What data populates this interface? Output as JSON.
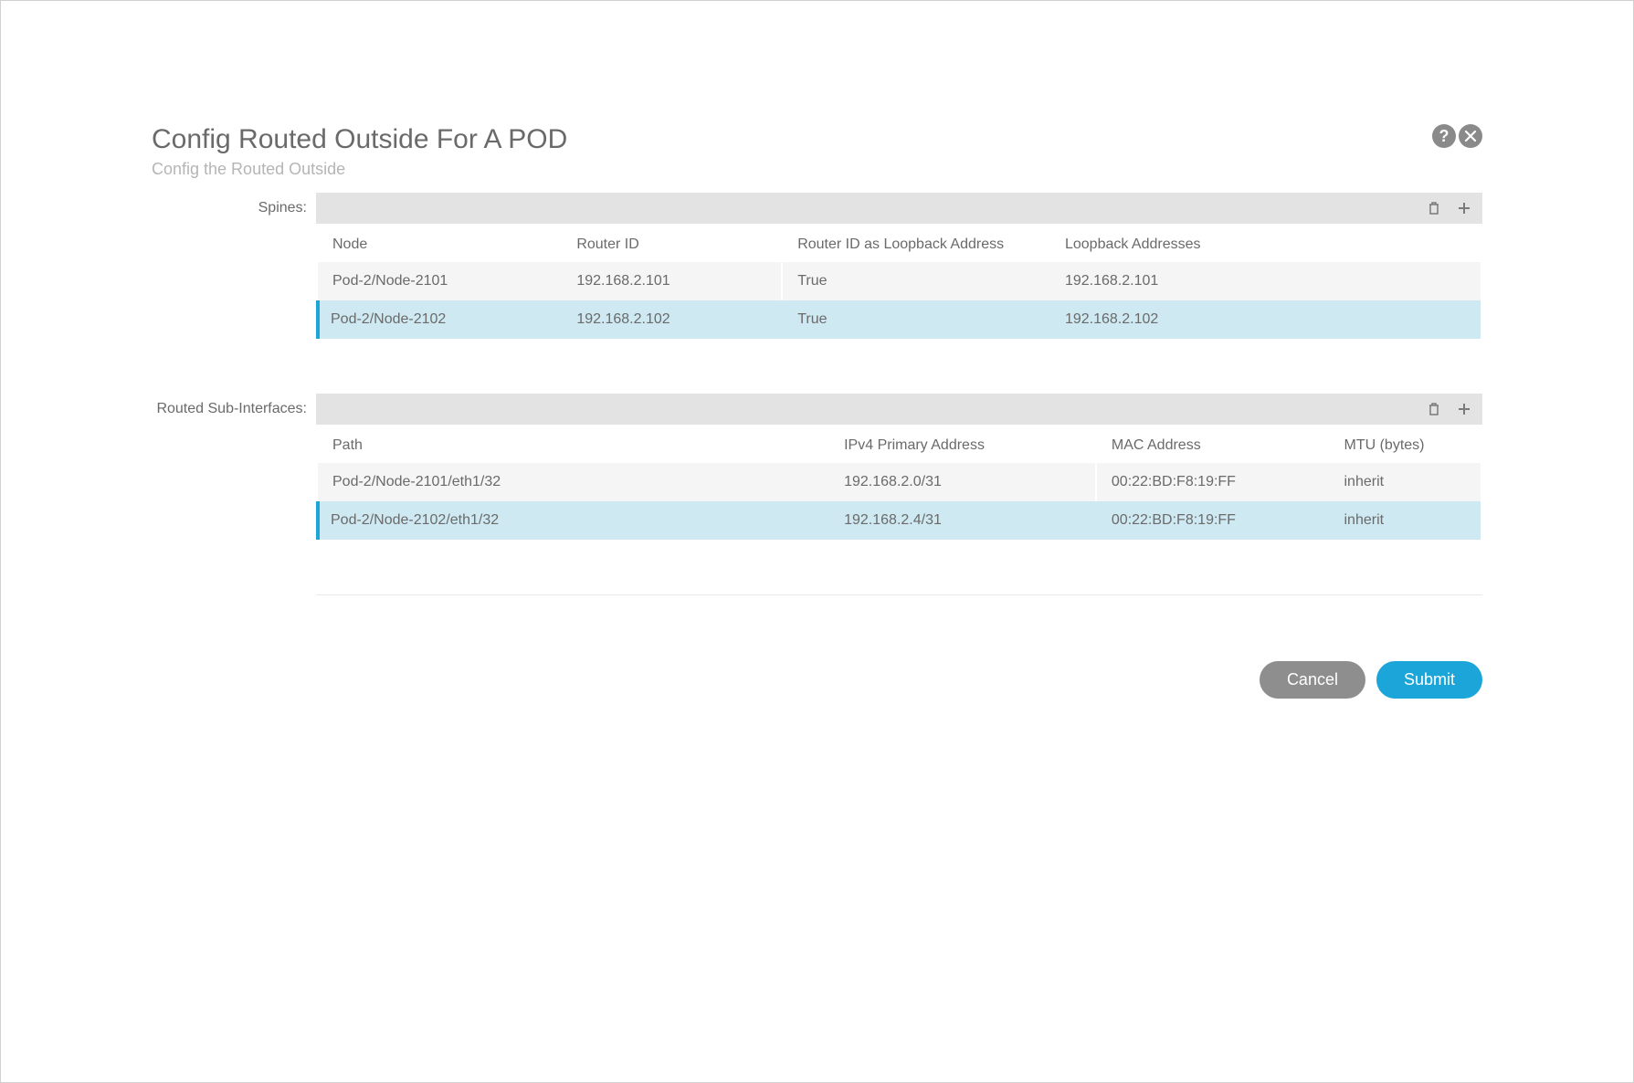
{
  "dialog": {
    "title": "Config Routed Outside For A POD",
    "subtitle": "Config the Routed Outside"
  },
  "spines": {
    "label": "Spines:",
    "columns": {
      "node": "Node",
      "router_id": "Router ID",
      "router_loopback": "Router ID as Loopback Address",
      "loopback_addresses": "Loopback Addresses"
    },
    "rows": [
      {
        "node": "Pod-2/Node-2101",
        "router_id": "192.168.2.101",
        "router_loopback": "True",
        "loopback_addresses": "192.168.2.101",
        "selected": false
      },
      {
        "node": "Pod-2/Node-2102",
        "router_id": "192.168.2.102",
        "router_loopback": "True",
        "loopback_addresses": "192.168.2.102",
        "selected": true
      }
    ]
  },
  "routed_sub_interfaces": {
    "label": "Routed Sub-Interfaces:",
    "columns": {
      "path": "Path",
      "ipv4": "IPv4 Primary Address",
      "mac": "MAC Address",
      "mtu": "MTU (bytes)"
    },
    "rows": [
      {
        "path": "Pod-2/Node-2101/eth1/32",
        "ipv4": "192.168.2.0/31",
        "mac": "00:22:BD:F8:19:FF",
        "mtu": "inherit",
        "selected": false
      },
      {
        "path": "Pod-2/Node-2102/eth1/32",
        "ipv4": "192.168.2.4/31",
        "mac": "00:22:BD:F8:19:FF",
        "mtu": "inherit",
        "selected": true
      }
    ]
  },
  "footer": {
    "cancel": "Cancel",
    "submit": "Submit"
  }
}
